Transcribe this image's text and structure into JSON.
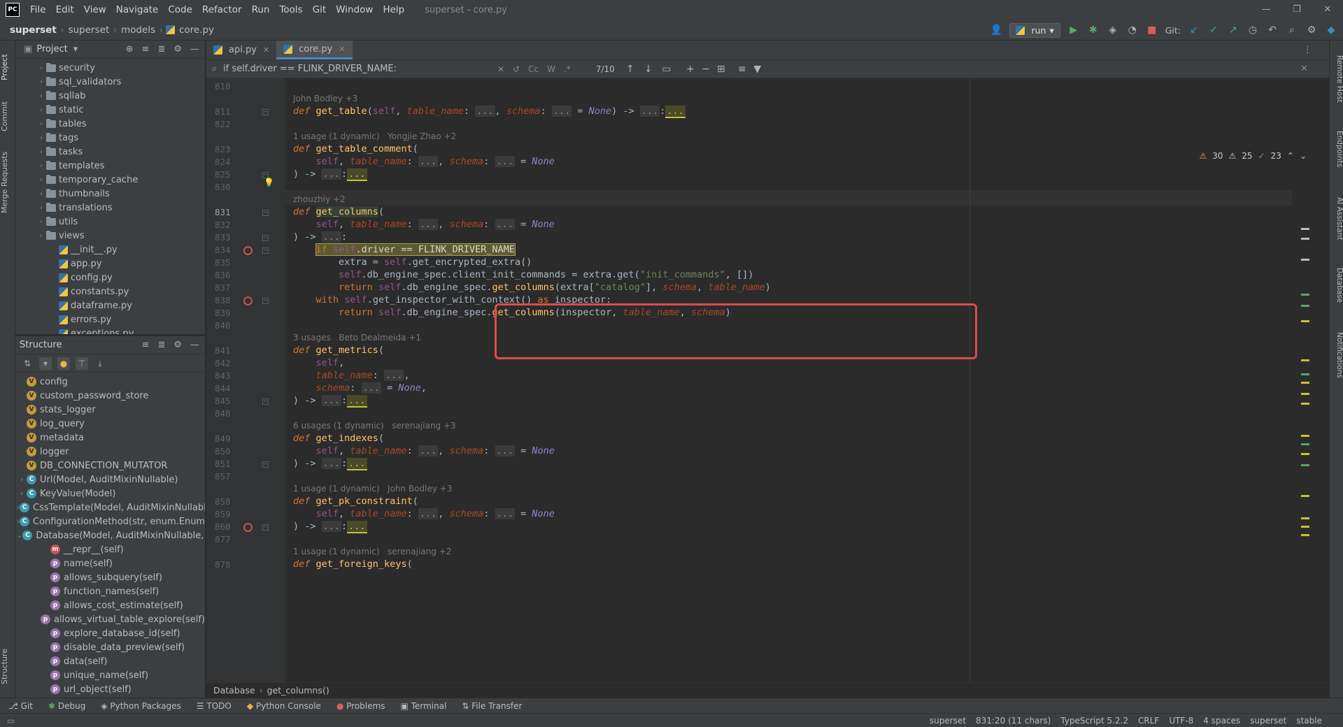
{
  "app": {
    "logo": "PC",
    "menu": [
      "File",
      "Edit",
      "View",
      "Navigate",
      "Code",
      "Refactor",
      "Run",
      "Tools",
      "Git",
      "Window",
      "Help"
    ],
    "title": "superset - core.py"
  },
  "nav": {
    "breadcrumbs": [
      "superset",
      "superset",
      "models",
      "core.py"
    ],
    "run_config": "run",
    "git_label": "Git:"
  },
  "left_tabs": [
    "Project",
    "Commit",
    "Merge Requests",
    "Structure"
  ],
  "right_tabs": [
    "Remote Host",
    "Endpoints",
    "AI Assistant",
    "Database",
    "Notifications"
  ],
  "project": {
    "title": "Project",
    "folders": [
      "security",
      "sql_validators",
      "sqllab",
      "static",
      "tables",
      "tags",
      "tasks",
      "templates",
      "temporary_cache",
      "thumbnails",
      "translations",
      "utils",
      "views"
    ],
    "files": [
      "__init__.py",
      "app.py",
      "config.py",
      "constants.py",
      "dataframe.py",
      "errors.py",
      "exceptions.py"
    ]
  },
  "structure": {
    "title": "Structure",
    "items": [
      {
        "badge": "V",
        "type": "v",
        "label": "config",
        "depth": 0
      },
      {
        "badge": "V",
        "type": "v",
        "label": "custom_password_store",
        "depth": 0
      },
      {
        "badge": "V",
        "type": "v",
        "label": "stats_logger",
        "depth": 0
      },
      {
        "badge": "V",
        "type": "v",
        "label": "log_query",
        "depth": 0
      },
      {
        "badge": "V",
        "type": "v",
        "label": "metadata",
        "depth": 0
      },
      {
        "badge": "V",
        "type": "v",
        "label": "logger",
        "depth": 0
      },
      {
        "badge": "V",
        "type": "v",
        "label": "DB_CONNECTION_MUTATOR",
        "depth": 0
      },
      {
        "badge": "C",
        "type": "c",
        "label": "Url(Model, AuditMixinNullable)",
        "depth": 0,
        "arrow": "›"
      },
      {
        "badge": "C",
        "type": "c",
        "label": "KeyValue(Model)",
        "depth": 0,
        "arrow": "›"
      },
      {
        "badge": "C",
        "type": "c",
        "label": "CssTemplate(Model, AuditMixinNullable",
        "depth": 0,
        "arrow": "›"
      },
      {
        "badge": "C",
        "type": "c",
        "label": "ConfigurationMethod(str, enum.Enum)",
        "depth": 0,
        "arrow": "›"
      },
      {
        "badge": "C",
        "type": "c",
        "label": "Database(Model, AuditMixinNullable, Ir",
        "depth": 0,
        "arrow": "⌄"
      },
      {
        "badge": "m",
        "type": "mr",
        "label": "__repr__(self)",
        "depth": 1
      },
      {
        "badge": "p",
        "type": "m",
        "label": "name(self)",
        "depth": 1
      },
      {
        "badge": "p",
        "type": "m",
        "label": "allows_subquery(self)",
        "depth": 1
      },
      {
        "badge": "p",
        "type": "m",
        "label": "function_names(self)",
        "depth": 1
      },
      {
        "badge": "p",
        "type": "m",
        "label": "allows_cost_estimate(self)",
        "depth": 1
      },
      {
        "badge": "p",
        "type": "m",
        "label": "allows_virtual_table_explore(self)",
        "depth": 1
      },
      {
        "badge": "p",
        "type": "m",
        "label": "explore_database_id(self)",
        "depth": 1
      },
      {
        "badge": "p",
        "type": "m",
        "label": "disable_data_preview(self)",
        "depth": 1
      },
      {
        "badge": "p",
        "type": "m",
        "label": "data(self)",
        "depth": 1
      },
      {
        "badge": "p",
        "type": "m",
        "label": "unique_name(self)",
        "depth": 1
      },
      {
        "badge": "p",
        "type": "m",
        "label": "url_object(self)",
        "depth": 1
      }
    ]
  },
  "tabs": [
    {
      "label": "api.py",
      "active": false
    },
    {
      "label": "core.py",
      "active": true
    }
  ],
  "find": {
    "query": "if self.driver == FLINK_DRIVER_NAME:",
    "case_label": "Cc",
    "word_label": "W",
    "regex_label": ".*",
    "count": "7/10"
  },
  "inspections": {
    "warnings_a": "30",
    "warnings_b": "25",
    "ok": "23"
  },
  "hints": {
    "h811": "John Bodley +3",
    "h823": "1 usage (1 dynamic)   Yongjie Zhao +2",
    "h831": "zhouzhiy +2",
    "h841": "3 usages   Beto Dealmeida +1",
    "h849": "6 usages (1 dynamic)   serenajiang +3",
    "h858": "1 usage (1 dynamic)   John Bodley +3",
    "h878": "1 usage (1 dynamic)   serenajiang +2"
  },
  "line_numbers": [
    "810",
    "811",
    "822",
    "823",
    "824",
    "825",
    "830",
    "831",
    "832",
    "833",
    "834",
    "835",
    "836",
    "837",
    "838",
    "839",
    "840",
    "841",
    "842",
    "843",
    "844",
    "845",
    "848",
    "849",
    "850",
    "851",
    "857",
    "858",
    "859",
    "860",
    "877",
    "878"
  ],
  "editor_breadcrumb": [
    "Database",
    "get_columns()"
  ],
  "bottom_tools": [
    "Git",
    "Debug",
    "Python Packages",
    "TODO",
    "Python Console",
    "Problems",
    "Terminal",
    "File Transfer"
  ],
  "status": {
    "project": "superset",
    "position": "831:20 (11 chars)",
    "language": "TypeScript 5.2.2",
    "line_sep": "CRLF",
    "encoding": "UTF-8",
    "indent": "4 spaces",
    "interpreter": "superset",
    "branch": "stable"
  }
}
